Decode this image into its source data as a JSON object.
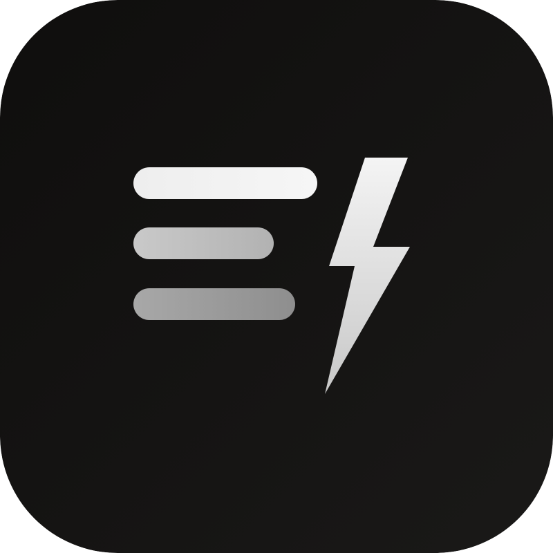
{
  "icon": {
    "name": "app-icon",
    "glyph": "lightning-bolt-with-lines",
    "background_color": "#0f0e0d",
    "background_highlight": "#1a1918",
    "line_colors": [
      "#f0f0f0",
      "#bdbdbd",
      "#9c9c9c"
    ],
    "bolt_color_light": "#f4f4f4",
    "bolt_color_dark": "#c8c8c8"
  }
}
